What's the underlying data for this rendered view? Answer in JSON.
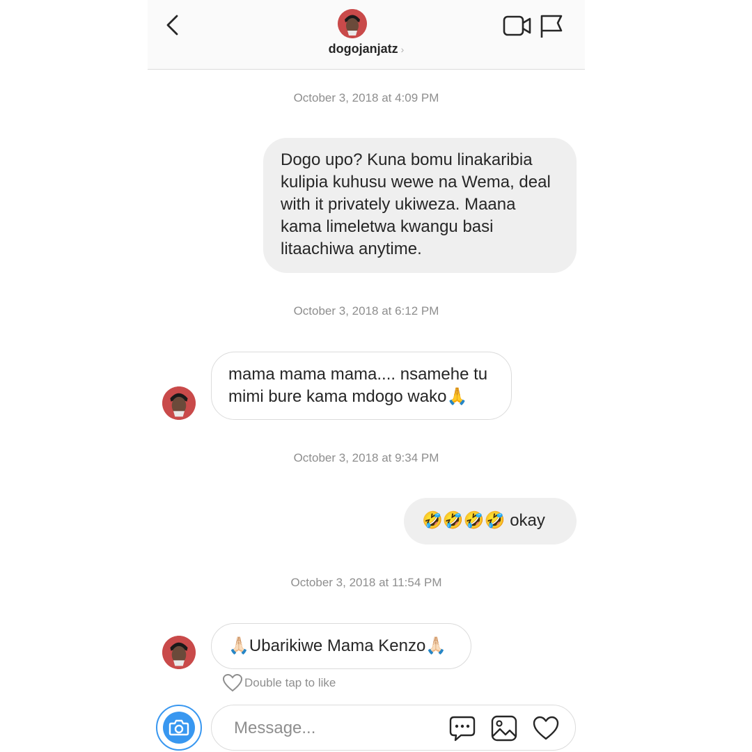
{
  "header": {
    "username": "dogojanjatz",
    "chevron": "›",
    "icons": [
      "back-chevron-icon",
      "avatar",
      "video-call-icon",
      "flag-icon"
    ]
  },
  "conversation": [
    {
      "type": "timestamp",
      "text": "October 3, 2018 at 4:09 PM"
    },
    {
      "type": "message",
      "direction": "outgoing",
      "lines": [
        "Dogo upo? Kuna bomu linakaribia",
        "kulipia kuhusu wewe na Wema, deal",
        "with it privately ukiweza. Maana",
        "kama limeletwa kwangu basi",
        "litaachiwa anytime."
      ]
    },
    {
      "type": "timestamp",
      "text": "October 3, 2018 at 6:12 PM"
    },
    {
      "type": "message",
      "direction": "incoming",
      "lines": [
        "mama mama mama.... nsamehe tu",
        "mimi bure kama mdogo wako🙏"
      ]
    },
    {
      "type": "timestamp",
      "text": "October 3, 2018 at 9:34 PM"
    },
    {
      "type": "message",
      "direction": "outgoing",
      "lines": [
        "🤣🤣🤣🤣 okay"
      ]
    },
    {
      "type": "timestamp",
      "text": "October 3, 2018 at 11:54 PM"
    },
    {
      "type": "message",
      "direction": "incoming",
      "lines": [
        "🙏🏻Ubarikiwe Mama Kenzo🙏🏻"
      ]
    }
  ],
  "like_hint": "Double tap to like",
  "composer": {
    "placeholder": "Message...",
    "icons": [
      "camera-icon",
      "chat-bubble-icon",
      "gallery-icon",
      "heart-icon"
    ]
  },
  "colors": {
    "accent_blue": "#3897f0",
    "outgoing_bubble": "#efefef",
    "incoming_border": "#dbdbdb",
    "timestamp_text": "#8e8e8e",
    "avatar_bg": "#c94a4a"
  }
}
